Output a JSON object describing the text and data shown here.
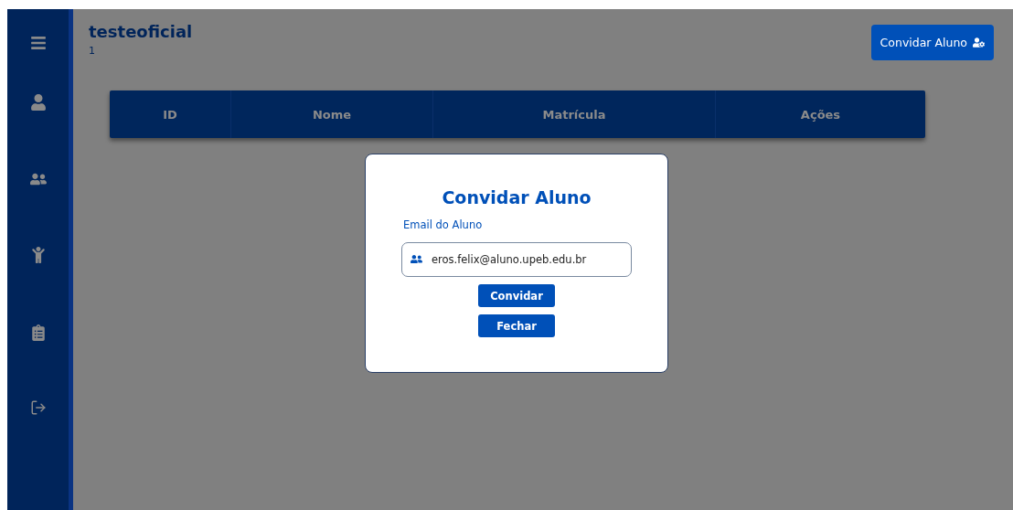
{
  "header": {
    "title": "testeoficial",
    "subtitle": "1",
    "invite_button": "Convidar Aluno"
  },
  "table": {
    "columns": [
      "ID",
      "Nome",
      "Matrícula",
      "Ações"
    ]
  },
  "dialog": {
    "title": "Convidar Aluno",
    "email_label": "Email do Aluno",
    "email_value": "eros.felix@aluno.upeb.edu.br",
    "buttons": [
      "Convidar",
      "Fechar"
    ]
  }
}
